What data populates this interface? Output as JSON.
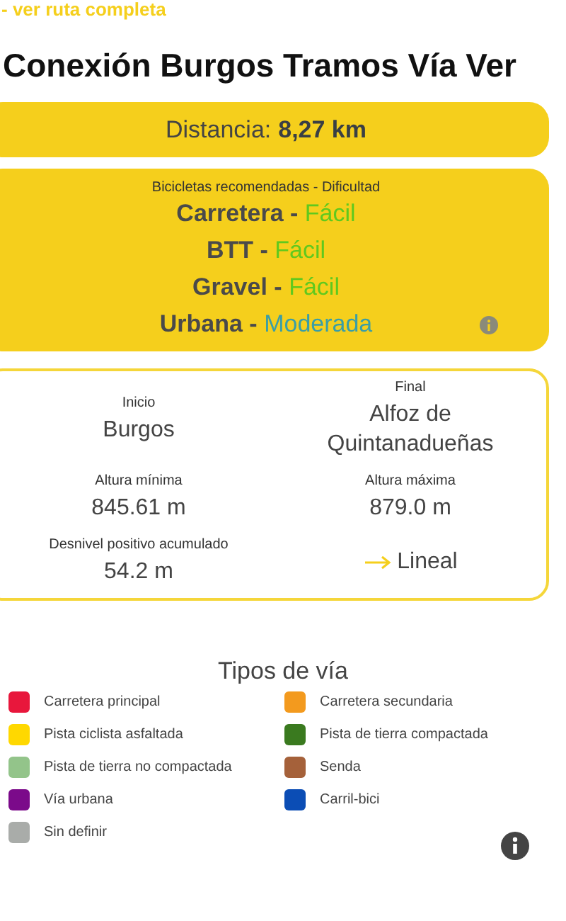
{
  "route_link": "- ver ruta completa",
  "title": "Conexión Burgos Tramos Vía Ver",
  "distance": {
    "label": "Distancia:",
    "value": "8,27 km"
  },
  "bikes": {
    "heading": "Bicicletas recomendadas - Dificultad",
    "separator": "-",
    "items": [
      {
        "bike": "Carretera",
        "difficulty": "Fácil",
        "color": "#5fc91e"
      },
      {
        "bike": "BTT",
        "difficulty": "Fácil",
        "color": "#5fc91e"
      },
      {
        "bike": "Gravel",
        "difficulty": "Fácil",
        "color": "#5fc91e"
      },
      {
        "bike": "Urbana",
        "difficulty": "Moderada",
        "color": "#3a9ea6"
      }
    ]
  },
  "details": [
    {
      "label": "Inicio",
      "value": "Burgos"
    },
    {
      "label": "Final",
      "value": "Alfoz de Quintanadueñas"
    },
    {
      "label": "Altura mínima",
      "value": "845.61 m"
    },
    {
      "label": "Altura máxima",
      "value": "879.0 m"
    },
    {
      "label": "Desnivel positivo acumulado",
      "value": "54.2 m"
    },
    {
      "kind": "route_type",
      "value": "Lineal"
    }
  ],
  "legend": {
    "title": "Tipos de vía",
    "items": [
      {
        "label": "Carretera principal",
        "color": "#e8173c"
      },
      {
        "label": "Carretera secundaria",
        "color": "#f39a1e"
      },
      {
        "label": "Pista ciclista asfaltada",
        "color": "#ffd800"
      },
      {
        "label": "Pista de tierra compactada",
        "color": "#3a7a1f"
      },
      {
        "label": "Pista de tierra no compactada",
        "color": "#93c48a"
      },
      {
        "label": "Senda",
        "color": "#a5613a"
      },
      {
        "label": "Vía urbana",
        "color": "#7b0a8a"
      },
      {
        "label": "Carril-bici",
        "color": "#0b4db5"
      },
      {
        "label": "Sin definir",
        "color": "#a9aca9"
      }
    ]
  }
}
